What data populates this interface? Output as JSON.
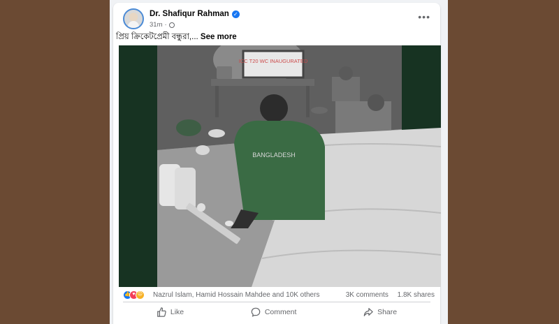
{
  "post": {
    "author": "Dr. Shafiqur Rahman",
    "time": "31m",
    "text": "প্রিয় ক্রিকেটপ্রেমী বন্ধুরা,...",
    "see_more": "See more",
    "image": {
      "tv_text": "ICC T20 WC INAUGURATED",
      "jersey_text": "BANGLADESH"
    },
    "reactions": {
      "names": "Nazrul Islam, Hamid Hossain Mahdee and 10K others",
      "comments": "3K comments",
      "shares": "1.8K shares"
    },
    "actions": {
      "like": "Like",
      "comment": "Comment",
      "share": "Share"
    }
  },
  "colors": {
    "background": "#6b4a33",
    "accent": "#1877f2",
    "image_side_panels": "#173322"
  }
}
